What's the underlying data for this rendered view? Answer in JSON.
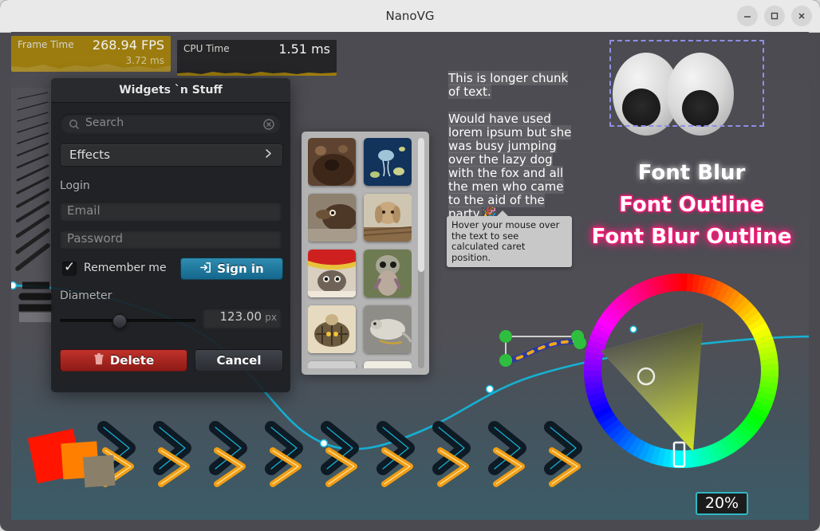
{
  "window": {
    "title": "NanoVG",
    "buttons": [
      {
        "name": "minimize",
        "glyph": "—"
      },
      {
        "name": "maximize",
        "glyph": "□"
      },
      {
        "name": "close",
        "glyph": "✕"
      }
    ]
  },
  "perf": {
    "fps_graph": {
      "label": "Frame Time",
      "value": "268.94 FPS",
      "sub": "3.72 ms",
      "color": "#9c7c0e"
    },
    "cpu_graph": {
      "label": "CPU Time",
      "value": "1.51 ms",
      "sub": "",
      "color": "#252527"
    }
  },
  "panel": {
    "title": "Widgets `n Stuff",
    "search": {
      "placeholder": "Search",
      "value": ""
    },
    "combo": {
      "label": "Effects"
    },
    "login_group_label": "Login",
    "email": {
      "placeholder": "Email",
      "value": ""
    },
    "password": {
      "placeholder": "Password",
      "value": ""
    },
    "checkbox": {
      "label": "Remember me",
      "checked": true,
      "glyph": "✓"
    },
    "sign_in_button": {
      "label": "Sign in",
      "icon": "login-icon",
      "color": "#2f8cb0"
    },
    "slider_label": "Diameter",
    "slider": {
      "value": 123.0,
      "min": 0,
      "max": 300,
      "pos_pct": 38
    },
    "number_field": {
      "value": "123.00",
      "unit": "px"
    },
    "delete_button": {
      "label": "Delete",
      "icon": "trash-icon",
      "color": "#c0322b"
    },
    "cancel_button": {
      "label": "Cancel",
      "color": "#41434a"
    }
  },
  "thumbnails": {
    "count": 12,
    "scroll_pct": 0,
    "items": [
      {
        "alt": "dog-nose",
        "c1": "#6b4a33",
        "c2": "#3a2418"
      },
      {
        "alt": "jellyfish",
        "c1": "#123a63",
        "c2": "#0a2murmur"
      },
      {
        "alt": "shrew",
        "c1": "#8d7f6e",
        "c2": "#3d2e22"
      },
      {
        "alt": "rabbit",
        "c1": "#d8c7ab",
        "c2": "#8a6b47"
      },
      {
        "alt": "cat-in-blanket",
        "c1": "#cf2020",
        "c2": "#5a4a3a"
      },
      {
        "alt": "loris",
        "c1": "#9aa08c",
        "c2": "#4a4436"
      },
      {
        "alt": "tortoise",
        "c1": "#e2d3b6",
        "c2": "#7a6140"
      },
      {
        "alt": "mouse",
        "c1": "#9a9a94",
        "c2": "#6a6a62"
      },
      {
        "alt": "white-blob",
        "c1": "#d8d8d8",
        "c2": "#8f8f8f"
      },
      {
        "alt": "pale-animal",
        "c1": "#efeade",
        "c2": "#b9b19c"
      }
    ]
  },
  "paragraph": {
    "line1": "This is longer chunk",
    "line2": "of text.",
    "body": "Would have used lorem ipsum but she was busy jumping over the lazy dog with the fox and all the men who came to the aid of the party.",
    "emoji": "🎉"
  },
  "tooltip": {
    "text": "Hover your mouse over the text to see calculated caret position."
  },
  "eyes": {
    "label": "eyes-widget",
    "dashed_border_color": "#8f8fe8"
  },
  "font_effects": [
    {
      "name": "font-blur",
      "text": "Font Blur",
      "color": "#ffffff"
    },
    {
      "name": "font-outline",
      "text": "Font Outline",
      "color": "#ff1a7a"
    },
    {
      "name": "font-blur-outline",
      "text": "Font Blur Outline",
      "color": "#ff1a7a"
    }
  ],
  "color_wheel": {
    "name": "color-picker-wheel",
    "hue_marker_deg": 90,
    "selected_swatch": "#c8dd3a"
  },
  "percent_badge": {
    "value": "20%",
    "border_color": "#2fb7c3"
  },
  "graph": {
    "name": "spline-graph",
    "line_color": "#13b5d8",
    "node_color": "#ffffff"
  },
  "bezier_widget": {
    "handle_color": "#2fbf3f",
    "curve_color": "#2b3a9b",
    "dash_color": "#f0a61a"
  },
  "chevrons": {
    "dark_color": "#0e1a24",
    "dark_stroke": "#13b5d8",
    "orange_color": "#f5a013",
    "orange_stroke": "#ffd77a",
    "count": 9
  },
  "squares": {
    "red": "#ff1500",
    "orange": "#ff8000",
    "grey": "#8a8069"
  }
}
